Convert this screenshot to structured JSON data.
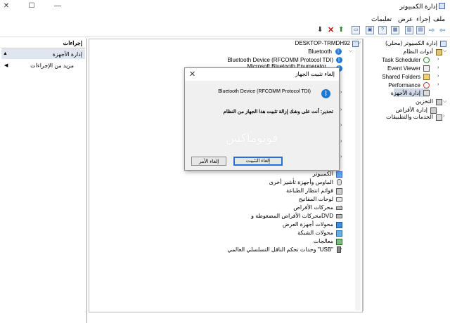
{
  "window": {
    "title": "إدارة الكمبيوتر"
  },
  "menu": [
    "ملف",
    "إجراء",
    "عرض",
    "تعليمات"
  ],
  "actions_panel": {
    "header": "إجراءات",
    "selected": "إدارة الأجهزة",
    "more": "مزيد من الإجراءات"
  },
  "device_tree": {
    "root": "DESKTOP-TRMDH92",
    "bluetooth": "Bluetooth",
    "bt_device_1": "Bluetooth Device (RFCOMM Protocol TDI)",
    "bt_device_2": "Microsoft Bluetooth Enumerator",
    "categories": [
      "الكمبيوتر",
      "الماوس وأجهزة تأشير أخرى",
      "قوائم انتظار الطباعة",
      "لوحات المفاتيح",
      "محركات الأقراص",
      "محركات الأقراص المضغوطة وDVD",
      "محولات أجهزة العرض",
      "محولات الشبكة",
      "معالجات",
      "وحدات تحكم الناقل التسلسلي العالمي \"USB\""
    ]
  },
  "left_tree": {
    "root": "إدارة الكمبيوتر (محلي)",
    "system_tools": "أدوات النظام",
    "items": [
      "Task Scheduler",
      "Event Viewer",
      "Shared Folders",
      "Performance",
      "إدارة الأجهزة"
    ],
    "storage": "التخزين",
    "disk_mgmt": "إدارة الأقراص",
    "services": "الخدمات والتطبيقات"
  },
  "dialog": {
    "title": "إلغاء تثبيت الجهاز",
    "device_name": "Bluetooth Device (RFCOMM Protocol TDI)",
    "warning": "تحذير: أنت على وشك إزالة تثبيت هذا الجهاز من النظام",
    "watermark": "فونوماكس",
    "uninstall_label": "إلغاء التثبيت",
    "cancel_label": "إلغاء الأمر"
  },
  "colors": {
    "accent": "#2a6fd6",
    "bluetooth": "#1d77d6",
    "selection": "#dfe6f0"
  }
}
